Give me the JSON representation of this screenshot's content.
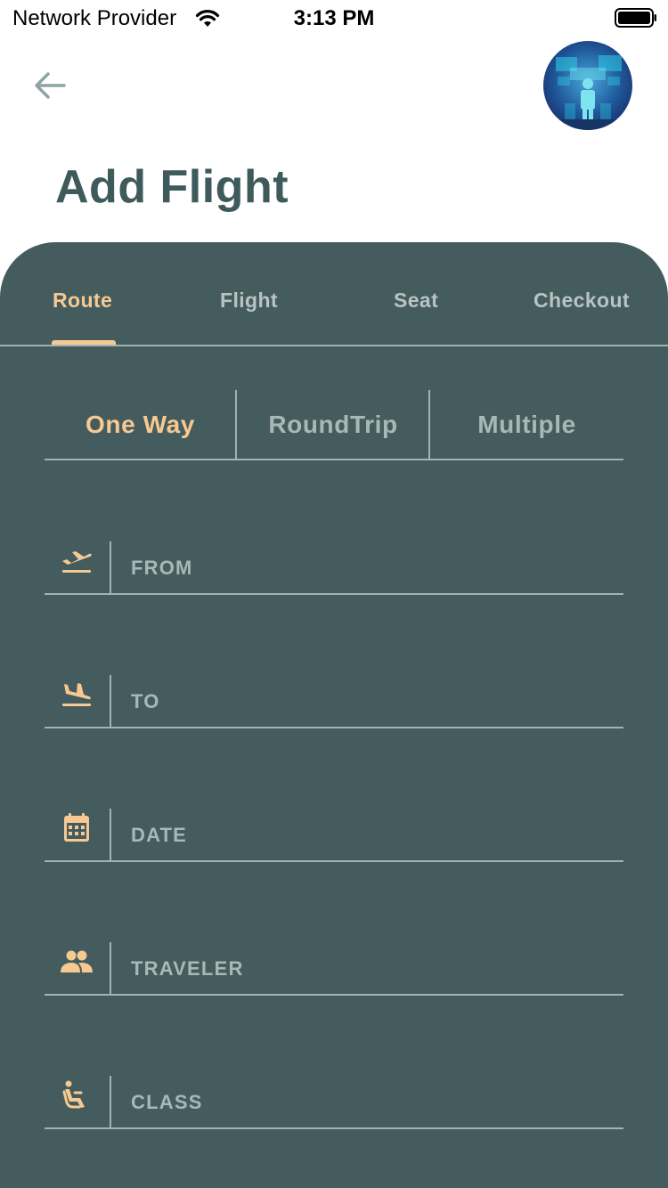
{
  "status_bar": {
    "carrier": "Network Provider",
    "time": "3:13 PM"
  },
  "header": {
    "title": "Add Flight"
  },
  "tabs": [
    {
      "label": "Route",
      "active": true
    },
    {
      "label": "Flight",
      "active": false
    },
    {
      "label": "Seat",
      "active": false
    },
    {
      "label": "Checkout",
      "active": false
    }
  ],
  "trip_type": [
    {
      "label": "One Way",
      "active": true
    },
    {
      "label": "RoundTrip",
      "active": false
    },
    {
      "label": "Multiple",
      "active": false
    }
  ],
  "fields": [
    {
      "label": "FROM",
      "icon": "flight-takeoff-icon"
    },
    {
      "label": "TO",
      "icon": "flight-land-icon"
    },
    {
      "label": "DATE",
      "icon": "calendar-icon"
    },
    {
      "label": "TRAVELER",
      "icon": "people-icon"
    },
    {
      "label": "CLASS",
      "icon": "seat-icon"
    }
  ],
  "colors": {
    "panel": "#445c5d",
    "title": "#3e5a5b",
    "accent": "#f7c992",
    "muted": "#a9b8b7"
  }
}
